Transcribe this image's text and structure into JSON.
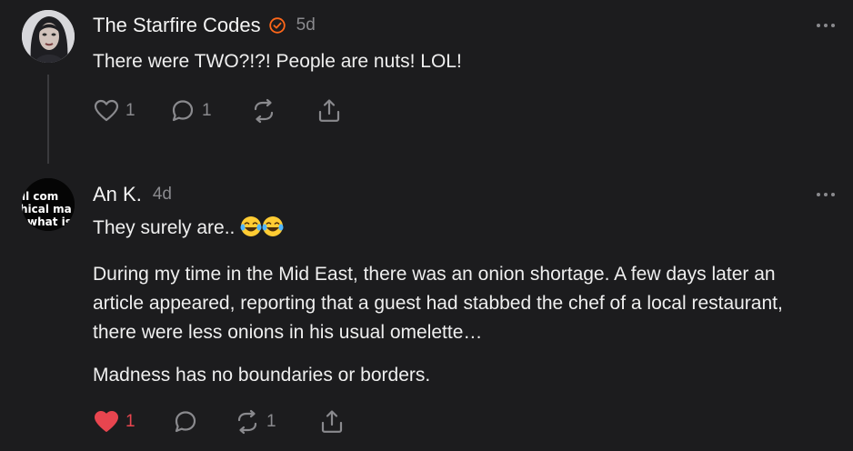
{
  "comments": [
    {
      "author": "The Starfire Codes",
      "verified": true,
      "time": "5d",
      "paragraphs": [
        "There were TWO?!?! People are nuts! LOL!"
      ],
      "likes": "1",
      "liked": false,
      "replies": "1",
      "restacks": "",
      "avatar": "woman-portrait"
    },
    {
      "author": "An K.",
      "verified": false,
      "time": "4d",
      "avatar_text": [
        "ll com",
        "hical ma",
        "what is"
      ],
      "first_line": "They surely are..",
      "emoji": "😂😂",
      "paragraphs": [
        "During my time in the Mid East, there was an onion shortage. A few days later an article appeared, reporting that a guest had stabbed the chef of a local restaurant, there were less onions in his usual omelette…",
        "Madness has no boundaries or borders."
      ],
      "likes": "1",
      "liked": true,
      "replies": "",
      "restacks": "1"
    }
  ],
  "colors": {
    "background": "#1c1c1e",
    "muted": "#8a8a8e",
    "verified": "#ff6719",
    "liked": "#e8454f"
  },
  "icons": [
    "heart-icon",
    "comment-icon",
    "restack-icon",
    "share-icon",
    "more-icon",
    "verified-icon"
  ]
}
